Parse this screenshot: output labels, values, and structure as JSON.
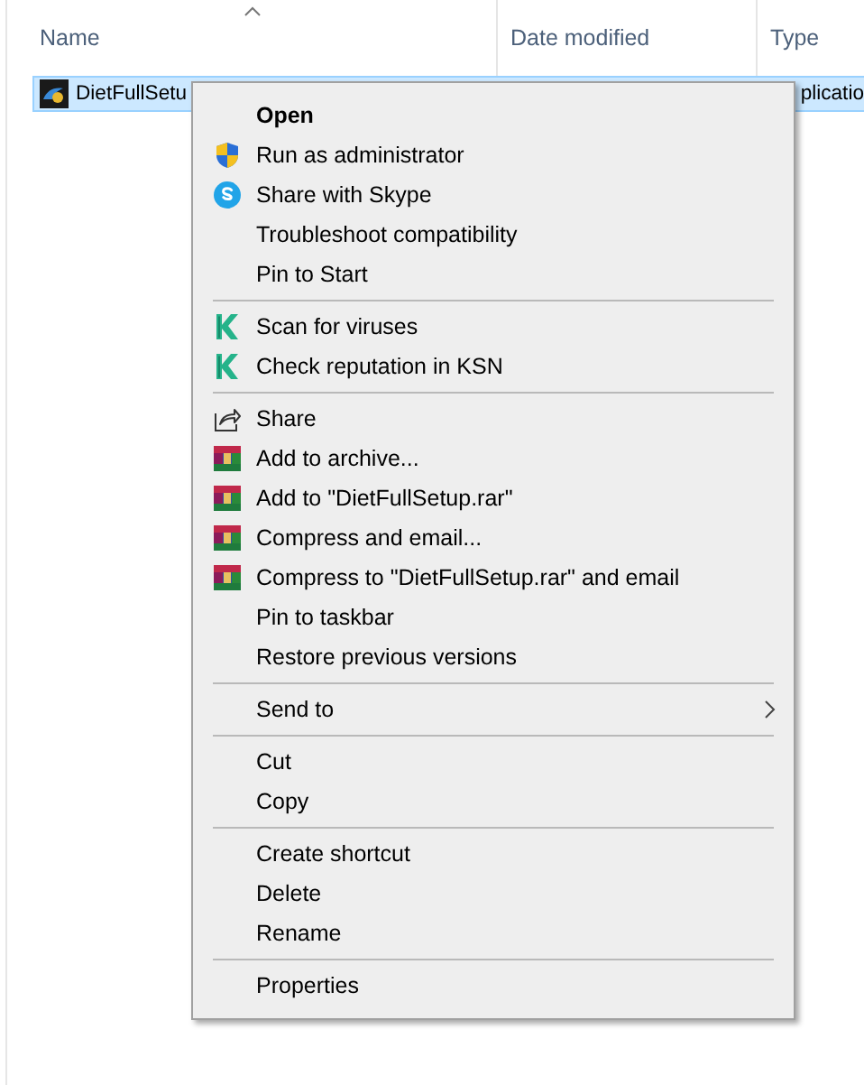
{
  "file_list": {
    "columns": [
      {
        "label": "Name",
        "sorted": true
      },
      {
        "label": "Date modified",
        "sorted": false
      },
      {
        "label": "Type",
        "sorted": false
      }
    ],
    "rows": [
      {
        "name": "DietFullSetu",
        "type": "plicatio",
        "selected": true
      }
    ]
  },
  "context_menu": {
    "items": [
      {
        "kind": "default",
        "label": "Open"
      },
      {
        "kind": "shield",
        "label": "Run as administrator"
      },
      {
        "kind": "skype",
        "label": "Share with Skype"
      },
      {
        "kind": "item",
        "label": "Troubleshoot compatibility"
      },
      {
        "kind": "item",
        "label": "Pin to Start"
      },
      {
        "kind": "separator"
      },
      {
        "kind": "antivirus",
        "label": "Scan for viruses"
      },
      {
        "kind": "antivirus",
        "label": "Check reputation in KSN"
      },
      {
        "kind": "separator"
      },
      {
        "kind": "share",
        "label": "Share"
      },
      {
        "kind": "archive",
        "label": "Add to archive..."
      },
      {
        "kind": "archive",
        "label": "Add to \"DietFullSetup.rar\""
      },
      {
        "kind": "archive",
        "label": "Compress and email..."
      },
      {
        "kind": "archive",
        "label": "Compress to \"DietFullSetup.rar\" and email"
      },
      {
        "kind": "item",
        "label": "Pin to taskbar"
      },
      {
        "kind": "item",
        "label": "Restore previous versions"
      },
      {
        "kind": "separator"
      },
      {
        "kind": "submenu",
        "label": "Send to"
      },
      {
        "kind": "separator"
      },
      {
        "kind": "item",
        "label": "Cut"
      },
      {
        "kind": "item",
        "label": "Copy"
      },
      {
        "kind": "separator"
      },
      {
        "kind": "item",
        "label": "Create shortcut"
      },
      {
        "kind": "item",
        "label": "Delete"
      },
      {
        "kind": "item",
        "label": "Rename"
      },
      {
        "kind": "separator"
      },
      {
        "kind": "item",
        "label": "Properties"
      }
    ]
  }
}
